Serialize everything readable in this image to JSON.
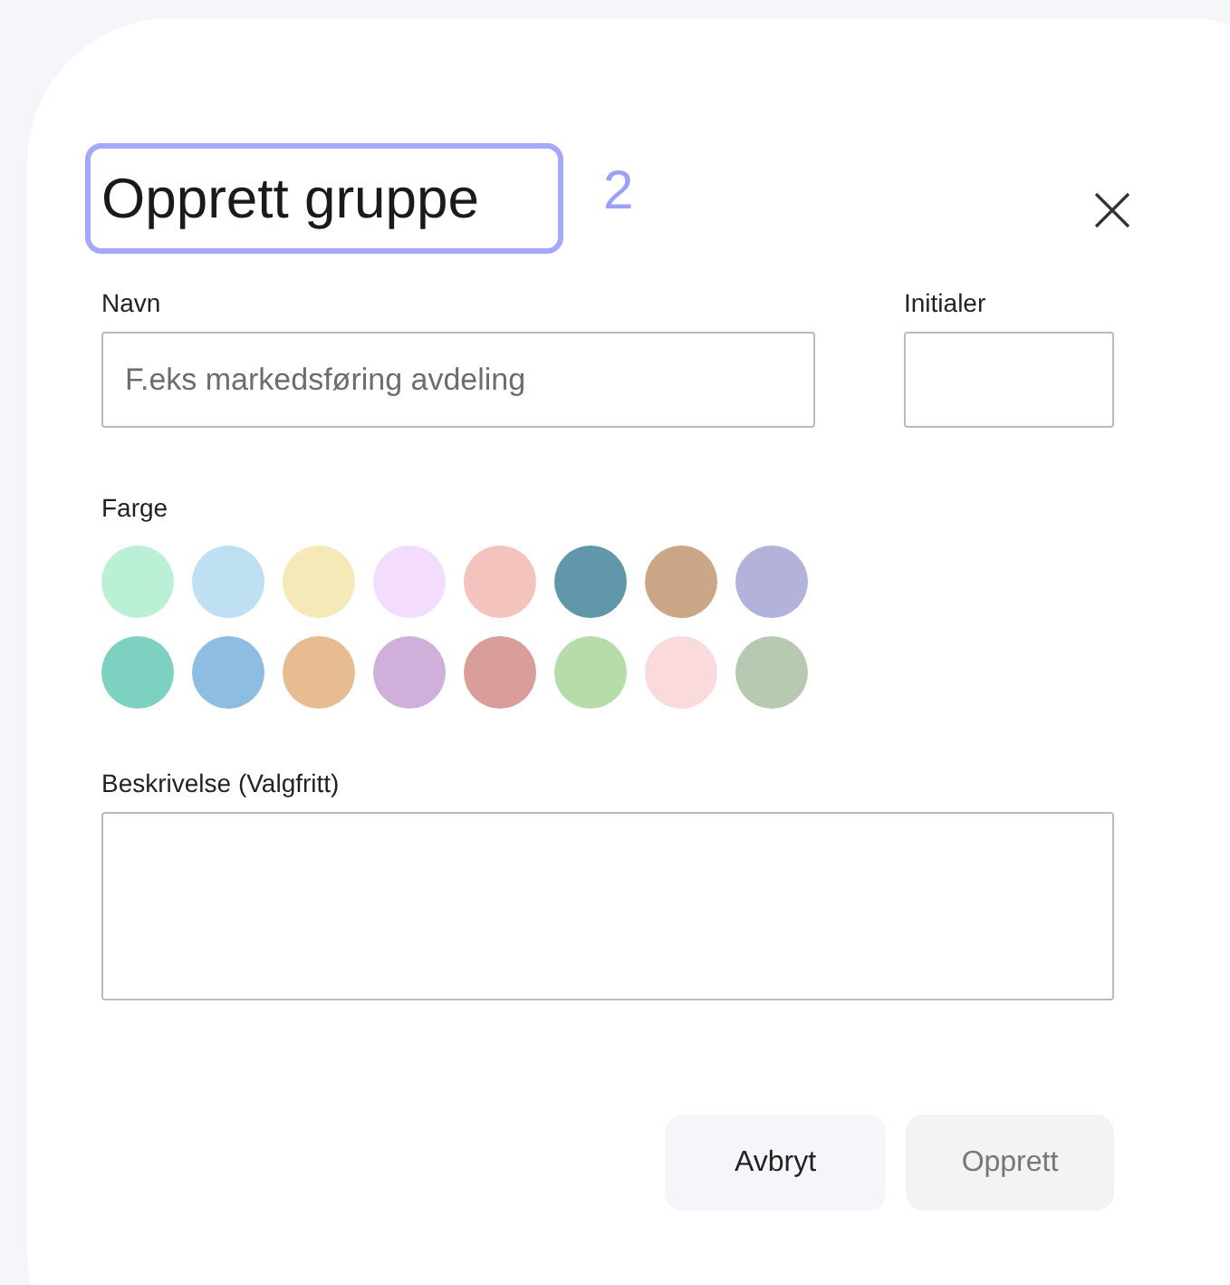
{
  "dialog": {
    "title": "Opprett gruppe",
    "annotation": {
      "label": "2"
    }
  },
  "fields": [
    {
      "label": "Navn",
      "placeholder": "F.eks markedsføring avdeling",
      "kind": "wide"
    },
    {
      "label": "Initialer",
      "kind": "narrow"
    }
  ],
  "colors": {
    "label": "Farge",
    "swatches": [
      {
        "color": "#baf0d6"
      },
      {
        "color": "#bfdff3"
      },
      {
        "color": "#f5e9b8"
      },
      {
        "color": "#f3dcfd"
      },
      {
        "color": "#f5c3bd"
      },
      {
        "color": "#6097ab"
      },
      {
        "color": "#cba788"
      },
      {
        "color": "#b2b2db"
      },
      {
        "color": "#7dd1c1"
      },
      {
        "color": "#8dbde0"
      },
      {
        "color": "#e8bc91"
      },
      {
        "color": "#d0b0da"
      },
      {
        "color": "#d99e9a"
      },
      {
        "color": "#b6dcaa"
      },
      {
        "color": "#fadadd"
      },
      {
        "color": "#b7c9b0"
      }
    ]
  },
  "description": {
    "label": "Beskrivelse (Valgfritt)"
  },
  "buttons": [
    {
      "label": "Avbryt",
      "disabled": false
    },
    {
      "label": "Opprett",
      "disabled": true
    }
  ]
}
